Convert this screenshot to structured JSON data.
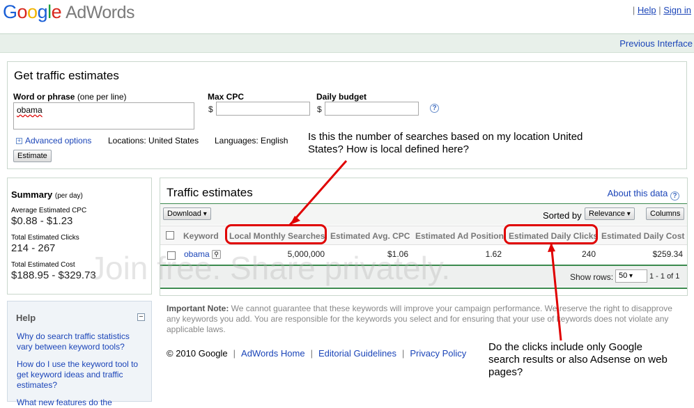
{
  "header": {
    "logo_google": [
      "G",
      "o",
      "o",
      "g",
      "l",
      "e"
    ],
    "logo_product": "AdWords",
    "help_link": "Help",
    "signin_link": "Sign in",
    "separator": "|",
    "previous_interface": "Previous Interface"
  },
  "estimates_form": {
    "title": "Get traffic estimates",
    "word_label_bold": "Word or phrase",
    "word_label_hint": "(one per line)",
    "word_value": "obama",
    "max_cpc_label": "Max CPC",
    "daily_budget_label": "Daily budget",
    "currency": "$",
    "help_icon": "?",
    "advanced_options": "Advanced options",
    "locations": "Locations: United States",
    "languages": "Languages: English",
    "estimate_button": "Estimate"
  },
  "summary": {
    "title": "Summary",
    "title_hint": "(per day)",
    "avg_cpc_label": "Average Estimated CPC",
    "avg_cpc_value": "$0.88 - $1.23",
    "clicks_label": "Total Estimated Clicks",
    "clicks_value": "214 - 267",
    "cost_label": "Total Estimated Cost",
    "cost_value": "$188.95 - $329.73"
  },
  "help": {
    "title": "Help",
    "links": [
      "Why do search traffic statistics vary between keyword tools?",
      "How do I use the keyword tool to get keyword ideas and traffic estimates?",
      "What new features do the"
    ]
  },
  "traffic": {
    "title": "Traffic estimates",
    "about": "About this data",
    "download": "Download",
    "sorted_by": "Sorted by",
    "relevance": "Relevance",
    "columns": "Columns",
    "headers": [
      "Keyword",
      "Local Monthly Searches",
      "Estimated Avg. CPC",
      "Estimated Ad Position",
      "Estimated Daily Clicks",
      "Estimated Daily Cost"
    ],
    "row": {
      "keyword": "obama",
      "searches": "5,000,000",
      "cpc": "$1.06",
      "position": "1.62",
      "clicks": "240",
      "cost": "$259.34"
    },
    "show_rows_label": "Show rows:",
    "show_rows_value": "50",
    "pagination": "1 - 1 of 1"
  },
  "note": {
    "bold": "Important Note:",
    "text": " We cannot guarantee that these keywords will improve your campaign performance. We reserve the right to disapprove any keywords you add. You are responsible for the keywords you select and for ensuring that your use of keywords does not violate any applicable laws."
  },
  "footer": {
    "copyright": "© 2010 Google",
    "links": [
      "AdWords Home",
      "Editorial Guidelines",
      "Privacy Policy"
    ],
    "separator": "|"
  },
  "annotations": {
    "top": "Is this the number of searches based on my location United States? How is local defined here?",
    "bottom": "Do the clicks include only Google search results or also Adsense on web pages?",
    "color": "#e00000"
  },
  "watermark": "Join free. Share privately."
}
